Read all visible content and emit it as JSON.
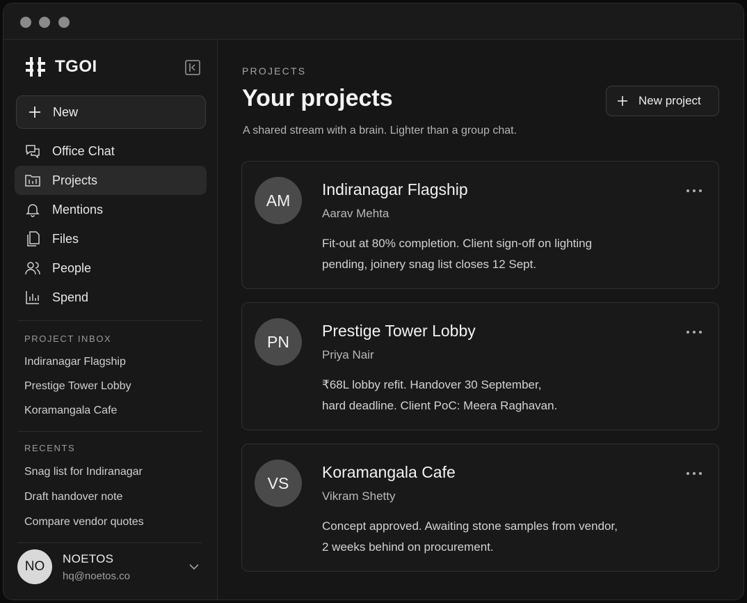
{
  "sidebar": {
    "brand": "TGOI",
    "new_label": "New",
    "nav": [
      {
        "label": "Office Chat",
        "icon": "chat-bubbles-icon"
      },
      {
        "label": "Projects",
        "icon": "folder-icon",
        "active": true
      },
      {
        "label": "Mentions",
        "icon": "bell-icon"
      },
      {
        "label": "Files",
        "icon": "files-icon"
      },
      {
        "label": "People",
        "icon": "people-icon"
      },
      {
        "label": "Spend",
        "icon": "bar-chart-icon"
      }
    ],
    "inbox_title": "PROJECT INBOX",
    "inbox": [
      "Indiranagar Flagship",
      "Prestige Tower Lobby",
      "Koramangala Cafe"
    ],
    "recents_title": "RECENTS",
    "recents": [
      "Snag list for Indiranagar",
      "Draft handover note",
      "Compare vendor quotes"
    ],
    "user": {
      "initials": "NO",
      "name": "NOETOS",
      "email": "hq@noetos.co"
    }
  },
  "main": {
    "eyebrow": "PROJECTS",
    "title": "Your projects",
    "subtitle": "A shared stream with a brain. Lighter than a group chat.",
    "new_project_label": "New project",
    "projects": [
      {
        "initials": "AM",
        "title": "Indiranagar Flagship",
        "owner": "Aarav Mehta",
        "desc_line1": "Fit-out at 80% completion. Client sign-off on lighting",
        "desc_line2": "pending, joinery snag list closes 12 Sept."
      },
      {
        "initials": "PN",
        "title": "Prestige Tower Lobby",
        "owner": "Priya Nair",
        "desc_line1": "₹68L lobby refit. Handover 30 September,",
        "desc_line2": "hard deadline. Client PoC: Meera Raghavan."
      },
      {
        "initials": "VS",
        "title": "Koramangala Cafe",
        "owner": "Vikram Shetty",
        "desc_line1": "Concept approved. Awaiting stone samples from vendor,",
        "desc_line2": "2 weeks behind on procurement."
      }
    ]
  },
  "colors": {
    "background": "#161616",
    "sidebar": "#181818",
    "card": "#191919",
    "border": "#303030",
    "text": "#ededed"
  }
}
